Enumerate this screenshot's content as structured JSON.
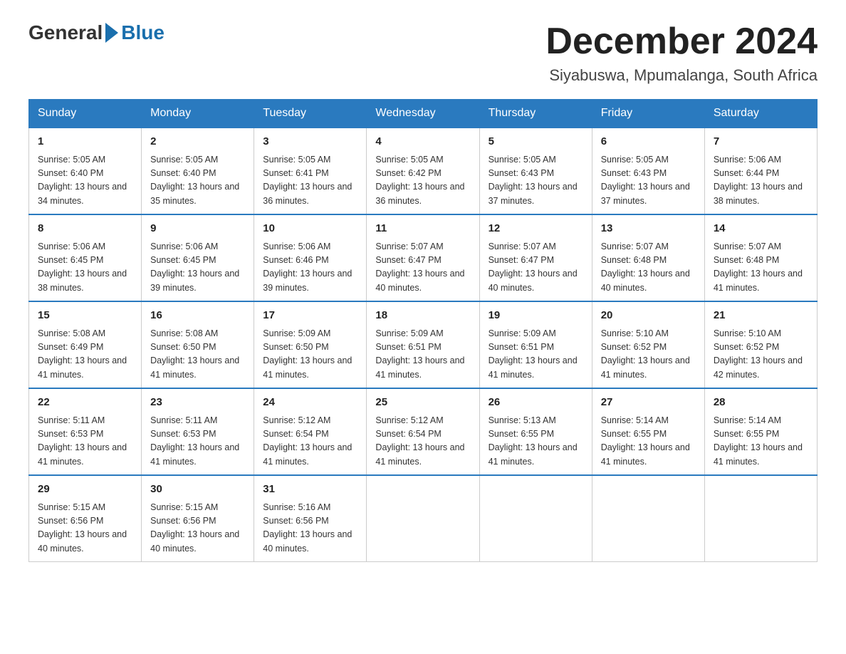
{
  "header": {
    "logo": {
      "general": "General",
      "blue": "Blue"
    },
    "title": "December 2024",
    "subtitle": "Siyabuswa, Mpumalanga, South Africa"
  },
  "weekdays": [
    "Sunday",
    "Monday",
    "Tuesday",
    "Wednesday",
    "Thursday",
    "Friday",
    "Saturday"
  ],
  "weeks": [
    [
      {
        "day": "1",
        "sunrise": "5:05 AM",
        "sunset": "6:40 PM",
        "daylight": "13 hours and 34 minutes."
      },
      {
        "day": "2",
        "sunrise": "5:05 AM",
        "sunset": "6:40 PM",
        "daylight": "13 hours and 35 minutes."
      },
      {
        "day": "3",
        "sunrise": "5:05 AM",
        "sunset": "6:41 PM",
        "daylight": "13 hours and 36 minutes."
      },
      {
        "day": "4",
        "sunrise": "5:05 AM",
        "sunset": "6:42 PM",
        "daylight": "13 hours and 36 minutes."
      },
      {
        "day": "5",
        "sunrise": "5:05 AM",
        "sunset": "6:43 PM",
        "daylight": "13 hours and 37 minutes."
      },
      {
        "day": "6",
        "sunrise": "5:05 AM",
        "sunset": "6:43 PM",
        "daylight": "13 hours and 37 minutes."
      },
      {
        "day": "7",
        "sunrise": "5:06 AM",
        "sunset": "6:44 PM",
        "daylight": "13 hours and 38 minutes."
      }
    ],
    [
      {
        "day": "8",
        "sunrise": "5:06 AM",
        "sunset": "6:45 PM",
        "daylight": "13 hours and 38 minutes."
      },
      {
        "day": "9",
        "sunrise": "5:06 AM",
        "sunset": "6:45 PM",
        "daylight": "13 hours and 39 minutes."
      },
      {
        "day": "10",
        "sunrise": "5:06 AM",
        "sunset": "6:46 PM",
        "daylight": "13 hours and 39 minutes."
      },
      {
        "day": "11",
        "sunrise": "5:07 AM",
        "sunset": "6:47 PM",
        "daylight": "13 hours and 40 minutes."
      },
      {
        "day": "12",
        "sunrise": "5:07 AM",
        "sunset": "6:47 PM",
        "daylight": "13 hours and 40 minutes."
      },
      {
        "day": "13",
        "sunrise": "5:07 AM",
        "sunset": "6:48 PM",
        "daylight": "13 hours and 40 minutes."
      },
      {
        "day": "14",
        "sunrise": "5:07 AM",
        "sunset": "6:48 PM",
        "daylight": "13 hours and 41 minutes."
      }
    ],
    [
      {
        "day": "15",
        "sunrise": "5:08 AM",
        "sunset": "6:49 PM",
        "daylight": "13 hours and 41 minutes."
      },
      {
        "day": "16",
        "sunrise": "5:08 AM",
        "sunset": "6:50 PM",
        "daylight": "13 hours and 41 minutes."
      },
      {
        "day": "17",
        "sunrise": "5:09 AM",
        "sunset": "6:50 PM",
        "daylight": "13 hours and 41 minutes."
      },
      {
        "day": "18",
        "sunrise": "5:09 AM",
        "sunset": "6:51 PM",
        "daylight": "13 hours and 41 minutes."
      },
      {
        "day": "19",
        "sunrise": "5:09 AM",
        "sunset": "6:51 PM",
        "daylight": "13 hours and 41 minutes."
      },
      {
        "day": "20",
        "sunrise": "5:10 AM",
        "sunset": "6:52 PM",
        "daylight": "13 hours and 41 minutes."
      },
      {
        "day": "21",
        "sunrise": "5:10 AM",
        "sunset": "6:52 PM",
        "daylight": "13 hours and 42 minutes."
      }
    ],
    [
      {
        "day": "22",
        "sunrise": "5:11 AM",
        "sunset": "6:53 PM",
        "daylight": "13 hours and 41 minutes."
      },
      {
        "day": "23",
        "sunrise": "5:11 AM",
        "sunset": "6:53 PM",
        "daylight": "13 hours and 41 minutes."
      },
      {
        "day": "24",
        "sunrise": "5:12 AM",
        "sunset": "6:54 PM",
        "daylight": "13 hours and 41 minutes."
      },
      {
        "day": "25",
        "sunrise": "5:12 AM",
        "sunset": "6:54 PM",
        "daylight": "13 hours and 41 minutes."
      },
      {
        "day": "26",
        "sunrise": "5:13 AM",
        "sunset": "6:55 PM",
        "daylight": "13 hours and 41 minutes."
      },
      {
        "day": "27",
        "sunrise": "5:14 AM",
        "sunset": "6:55 PM",
        "daylight": "13 hours and 41 minutes."
      },
      {
        "day": "28",
        "sunrise": "5:14 AM",
        "sunset": "6:55 PM",
        "daylight": "13 hours and 41 minutes."
      }
    ],
    [
      {
        "day": "29",
        "sunrise": "5:15 AM",
        "sunset": "6:56 PM",
        "daylight": "13 hours and 40 minutes."
      },
      {
        "day": "30",
        "sunrise": "5:15 AM",
        "sunset": "6:56 PM",
        "daylight": "13 hours and 40 minutes."
      },
      {
        "day": "31",
        "sunrise": "5:16 AM",
        "sunset": "6:56 PM",
        "daylight": "13 hours and 40 minutes."
      },
      null,
      null,
      null,
      null
    ]
  ]
}
